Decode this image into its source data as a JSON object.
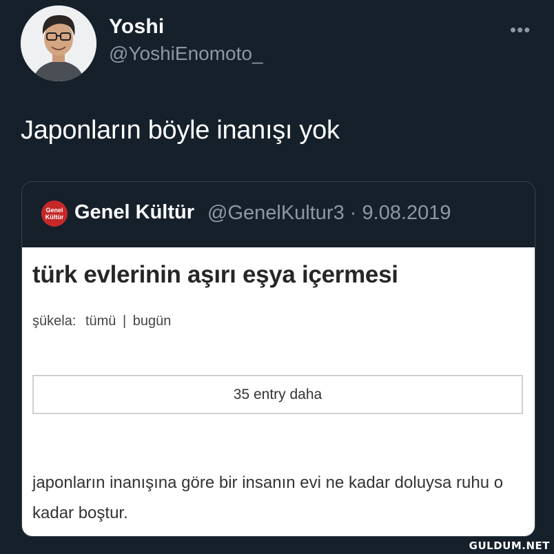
{
  "tweet": {
    "display_name": "Yoshi",
    "handle": "@YoshiEnomoto_",
    "more_icon": "more-horizontal-icon",
    "text": "Japonların böyle inanışı yok"
  },
  "quoted_tweet": {
    "logo_text_line1": "Genel",
    "logo_text_line2": "Kültür",
    "display_name": "Genel Kültür",
    "handle": "@GenelKultur3",
    "separator": "·",
    "date": "9.08.2019",
    "image": {
      "title": "türk evlerinin aşırı eşya içermesi",
      "sukela_label": "şükela:",
      "sukela_all": "tümü",
      "sukela_sep": "|",
      "sukela_today": "bugün",
      "more_entries": "35 entry daha",
      "entry_text": "japonların inanışına göre bir insanın evi ne kadar doluysa ruhu o kadar boştur."
    }
  },
  "watermark": "GULDUM.NET"
}
